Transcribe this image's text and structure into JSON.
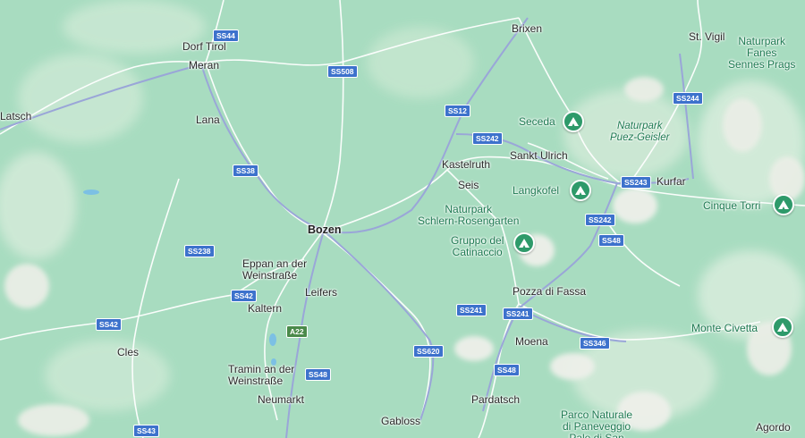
{
  "map": {
    "colors": {
      "land": "#a8dcc0",
      "mountain": "#c8e6d4",
      "rock": "#e8ece6",
      "road": "#ffffff",
      "major_road": "#9aa6d8",
      "water": "#7cc0e4",
      "park": "#1e7a52",
      "shield": "#3d72cc",
      "pin": "#2e9a6a"
    },
    "places": {
      "dorf_tirol": "Dorf Tirol",
      "meran": "Meran",
      "latsch": "Latsch",
      "lana": "Lana",
      "brixen": "Brixen",
      "st_vigil": "St. Vigil",
      "kastelruth": "Kastelruth",
      "seis": "Seis",
      "sankt_ulrich": "Sankt Ulrich",
      "kurfar": "Kurfar",
      "bozen": "Bozen",
      "eppan": "Eppan an der\nWeinstraße",
      "leifers": "Leifers",
      "kaltern": "Kaltern",
      "cles": "Cles",
      "tramin": "Tramin an der\nWeinstraße",
      "neumarkt": "Neumarkt",
      "gabloss": "Gabloss",
      "pardatsch": "Pardatsch",
      "moena": "Moena",
      "pozza": "Pozza di Fassa",
      "agordo": "Agordo"
    },
    "parks": {
      "fanes": "Naturpark\nFanes\nSennes Prags",
      "puez": "Naturpark\nPuez-Geisler",
      "schlern": "Naturpark\nSchlern-Rosengarten",
      "paneveggio": "Parco Naturale\ndi Paneveggio\nPale di San"
    },
    "pois": {
      "seceda": "Seceda",
      "langkofel": "Langkofel",
      "cinque_torri": "Cinque Torri",
      "catinaccio": "Gruppo del\nCatinaccio",
      "civetta": "Monte Civetta"
    },
    "routes": {
      "ss44": "SS44",
      "ss508": "SS508",
      "ss12": "SS12",
      "ss242a": "SS242",
      "ss244": "SS244",
      "ss38": "SS38",
      "ss243": "SS243",
      "ss242b": "SS242",
      "ss238": "SS238",
      "ss48a": "SS48",
      "ss42a": "SS42",
      "ss42b": "SS42",
      "ss241a": "SS241",
      "ss241b": "SS241",
      "a22": "A22",
      "ss346": "SS346",
      "ss620": "SS620",
      "ss48b": "SS48",
      "ss48c": "SS48",
      "ss43": "SS43"
    },
    "icons": {
      "poi": "mountain-peak-icon"
    }
  }
}
